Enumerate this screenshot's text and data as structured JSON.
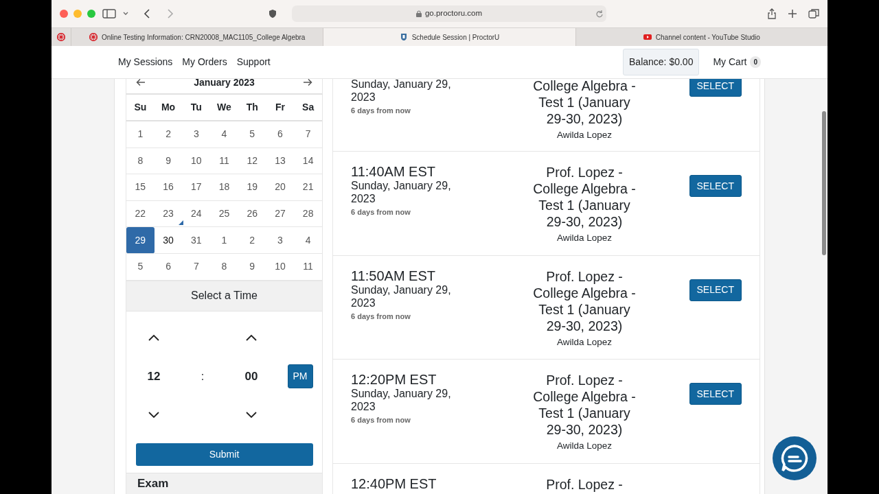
{
  "browser": {
    "address": "go.proctoru.com"
  },
  "tabs": [
    {
      "label": "Online Testing Information: CRN20008_MAC1105_College Algebra",
      "selected": false
    },
    {
      "label": "Schedule Session | ProctorU",
      "selected": true
    },
    {
      "label": "Channel content - YouTube Studio",
      "selected": false
    }
  ],
  "nav": {
    "links": [
      "My Sessions",
      "My Orders",
      "Support"
    ],
    "balance": "Balance: $0.00",
    "cart": "My Cart",
    "cart_count": "0"
  },
  "calendar": {
    "month": "January 2023",
    "weekdays": [
      "Su",
      "Mo",
      "Tu",
      "We",
      "Th",
      "Fr",
      "Sa"
    ],
    "weeks": [
      [
        {
          "day": "1",
          "selected": false,
          "available": false,
          "today": false
        },
        {
          "day": "2",
          "selected": false,
          "available": false,
          "today": false
        },
        {
          "day": "3",
          "selected": false,
          "available": false,
          "today": false
        },
        {
          "day": "4",
          "selected": false,
          "available": false,
          "today": false
        },
        {
          "day": "5",
          "selected": false,
          "available": false,
          "today": false
        },
        {
          "day": "6",
          "selected": false,
          "available": false,
          "today": false
        },
        {
          "day": "7",
          "selected": false,
          "available": false,
          "today": false
        }
      ],
      [
        {
          "day": "8",
          "selected": false,
          "available": false,
          "today": false
        },
        {
          "day": "9",
          "selected": false,
          "available": false,
          "today": false
        },
        {
          "day": "10",
          "selected": false,
          "available": false,
          "today": false
        },
        {
          "day": "11",
          "selected": false,
          "available": false,
          "today": false
        },
        {
          "day": "12",
          "selected": false,
          "available": false,
          "today": false
        },
        {
          "day": "13",
          "selected": false,
          "available": false,
          "today": false
        },
        {
          "day": "14",
          "selected": false,
          "available": false,
          "today": false
        }
      ],
      [
        {
          "day": "15",
          "selected": false,
          "available": false,
          "today": false
        },
        {
          "day": "16",
          "selected": false,
          "available": false,
          "today": false
        },
        {
          "day": "17",
          "selected": false,
          "available": false,
          "today": false
        },
        {
          "day": "18",
          "selected": false,
          "available": false,
          "today": false
        },
        {
          "day": "19",
          "selected": false,
          "available": false,
          "today": false
        },
        {
          "day": "20",
          "selected": false,
          "available": false,
          "today": false
        },
        {
          "day": "21",
          "selected": false,
          "available": false,
          "today": false
        }
      ],
      [
        {
          "day": "22",
          "selected": false,
          "available": false,
          "today": false
        },
        {
          "day": "23",
          "selected": false,
          "available": false,
          "today": true
        },
        {
          "day": "24",
          "selected": false,
          "available": false,
          "today": false
        },
        {
          "day": "25",
          "selected": false,
          "available": false,
          "today": false
        },
        {
          "day": "26",
          "selected": false,
          "available": false,
          "today": false
        },
        {
          "day": "27",
          "selected": false,
          "available": false,
          "today": false
        },
        {
          "day": "28",
          "selected": false,
          "available": false,
          "today": false
        }
      ],
      [
        {
          "day": "29",
          "selected": true,
          "available": true,
          "today": false
        },
        {
          "day": "30",
          "selected": false,
          "available": true,
          "today": false
        },
        {
          "day": "31",
          "selected": false,
          "available": false,
          "today": false
        },
        {
          "day": "1",
          "selected": false,
          "available": false,
          "today": false
        },
        {
          "day": "2",
          "selected": false,
          "available": false,
          "today": false
        },
        {
          "day": "3",
          "selected": false,
          "available": false,
          "today": false
        },
        {
          "day": "4",
          "selected": false,
          "available": false,
          "today": false
        }
      ],
      [
        {
          "day": "5",
          "selected": false,
          "available": false,
          "today": false
        },
        {
          "day": "6",
          "selected": false,
          "available": false,
          "today": false
        },
        {
          "day": "7",
          "selected": false,
          "available": false,
          "today": false
        },
        {
          "day": "8",
          "selected": false,
          "available": false,
          "today": false
        },
        {
          "day": "9",
          "selected": false,
          "available": false,
          "today": false
        },
        {
          "day": "10",
          "selected": false,
          "available": false,
          "today": false
        },
        {
          "day": "11",
          "selected": false,
          "available": false,
          "today": false
        }
      ]
    ]
  },
  "time_picker": {
    "title": "Select a Time",
    "hour": "12",
    "separator": ":",
    "minute": "00",
    "period": "PM",
    "submit": "Submit"
  },
  "exam_heading": "Exam",
  "sessions": [
    {
      "date": "Sunday, January 29, 2023",
      "relative": "6 days from now",
      "title": "College Algebra - Test 1 (January 29-30, 2023)",
      "proctor": "Awilda Lopez",
      "button": "SELECT"
    },
    {
      "time": "11:40AM EST",
      "date": "Sunday, January 29, 2023",
      "relative": "6 days from now",
      "title": "Prof. Lopez - College Algebra - Test 1 (January 29-30, 2023)",
      "proctor": "Awilda Lopez",
      "button": "SELECT"
    },
    {
      "time": "11:50AM EST",
      "date": "Sunday, January 29, 2023",
      "relative": "6 days from now",
      "title": "Prof. Lopez - College Algebra - Test 1 (January 29-30, 2023)",
      "proctor": "Awilda Lopez",
      "button": "SELECT"
    },
    {
      "time": "12:20PM EST",
      "date": "Sunday, January 29, 2023",
      "relative": "6 days from now",
      "title": "Prof. Lopez - College Algebra - Test 1 (January 29-30, 2023)",
      "proctor": "Awilda Lopez",
      "button": "SELECT"
    },
    {
      "time": "12:40PM EST",
      "title": "Prof. Lopez -"
    }
  ]
}
